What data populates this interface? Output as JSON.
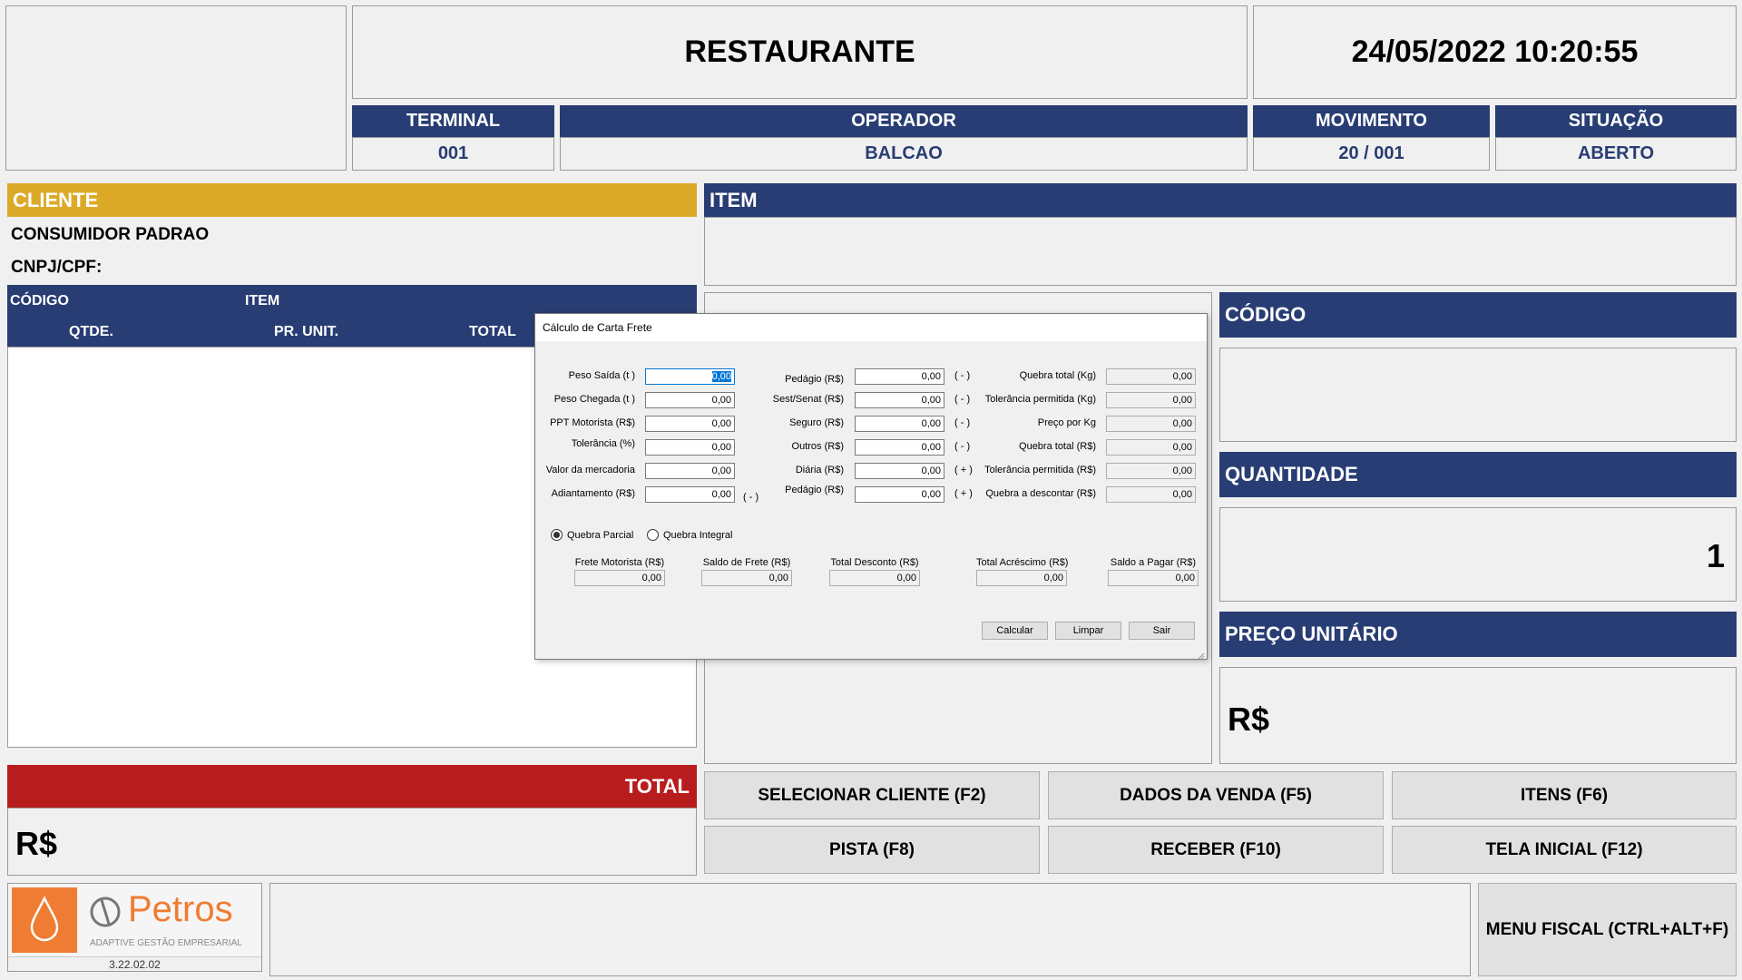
{
  "header": {
    "title": "RESTAURANTE",
    "datetime": "24/05/2022 10:20:55",
    "terminal_label": "TERMINAL",
    "terminal_value": "001",
    "operador_label": "OPERADOR",
    "operador_value": "BALCAO",
    "movimento_label": "MOVIMENTO",
    "movimento_value": "20 / 001",
    "situacao_label": "SITUAÇÃO",
    "situacao_value": "ABERTO"
  },
  "cliente": {
    "title": "CLIENTE",
    "name": "CONSUMIDOR PADRAO",
    "cnpj_label": "CNPJ/CPF:",
    "columns": {
      "codigo": "CÓDIGO",
      "item": "ITEM",
      "qtde": "QTDE.",
      "pr_unit": "PR. UNIT.",
      "total": "TOTAL"
    }
  },
  "item_panel": {
    "title": "ITEM"
  },
  "codigo_panel": {
    "title": "CÓDIGO"
  },
  "quantidade_panel": {
    "title": "QUANTIDADE",
    "value": "1"
  },
  "preco_panel": {
    "title": "PREÇO UNITÁRIO",
    "value": "R$"
  },
  "total_panel": {
    "title": "TOTAL",
    "value": "R$"
  },
  "buttons": {
    "selecionar_cliente": "SELECIONAR CLIENTE (F2)",
    "dados_venda": "DADOS DA VENDA (F5)",
    "itens": "ITENS (F6)",
    "pista": "PISTA (F8)",
    "receber": "RECEBER (F10)",
    "tela_inicial": "TELA INICIAL (F12)",
    "menu_fiscal": "MENU FISCAL (CTRL+ALT+F)"
  },
  "logo": {
    "brand": "Petros",
    "tagline": "ADAPTIVE GESTÃO EMPRESARIAL",
    "version": "3.22.02.02"
  },
  "colors": {
    "navy": "#283d73",
    "gold": "#dcaa28",
    "red": "#b91c1c",
    "logo_orange": "#f07c33"
  },
  "dialog": {
    "title": "Cálculo de Carta Frete",
    "col1": [
      {
        "label": "Peso Saída (t )",
        "value": "0,00",
        "sign": ""
      },
      {
        "label": "Peso Chegada (t )",
        "value": "0,00",
        "sign": ""
      },
      {
        "label": "PPT Motorista (R$)",
        "value": "0,00",
        "sign": ""
      },
      {
        "label": "Tolerância (%)",
        "value": "0,00",
        "sign": ""
      },
      {
        "label": "Valor da mercadoria",
        "value": "0,00",
        "sign": ""
      },
      {
        "label": "Adiantamento (R$)",
        "value": "0,00",
        "sign": "( - )"
      }
    ],
    "col2": [
      {
        "label": "Pedágio (R$)",
        "value": "0,00",
        "sign": "( - )"
      },
      {
        "label": "Sest/Senat (R$)",
        "value": "0,00",
        "sign": "( - )"
      },
      {
        "label": "Seguro (R$)",
        "value": "0,00",
        "sign": "( - )"
      },
      {
        "label": "Outros (R$)",
        "value": "0,00",
        "sign": "( - )"
      },
      {
        "label": "Diária (R$)",
        "value": "0,00",
        "sign": "( + )"
      },
      {
        "label": "Pedágio (R$)",
        "value": "0,00",
        "sign": "( + )"
      }
    ],
    "col3": [
      {
        "label": "Quebra total (Kg)",
        "value": "0,00"
      },
      {
        "label": "Tolerância permitida (Kg)",
        "value": "0,00"
      },
      {
        "label": "Preço por Kg",
        "value": "0,00"
      },
      {
        "label": "Quebra total (R$)",
        "value": "0,00"
      },
      {
        "label": "Tolerância permitida (R$)",
        "value": "0,00"
      },
      {
        "label": "Quebra a descontar (R$)",
        "value": "0,00"
      }
    ],
    "radio_parcial": "Quebra Parcial",
    "radio_integral": "Quebra Integral",
    "bottom": [
      {
        "label": "Frete Motorista (R$)",
        "value": "0,00"
      },
      {
        "label": "Saldo de Frete (R$)",
        "value": "0,00"
      },
      {
        "label": "Total Desconto (R$)",
        "value": "0,00"
      },
      {
        "label": "Total Acréscimo (R$)",
        "value": "0,00"
      },
      {
        "label": "Saldo a Pagar (R$)",
        "value": "0,00"
      }
    ],
    "btn_calcular": "Calcular",
    "btn_limpar": "Limpar",
    "btn_sair": "Sair"
  }
}
